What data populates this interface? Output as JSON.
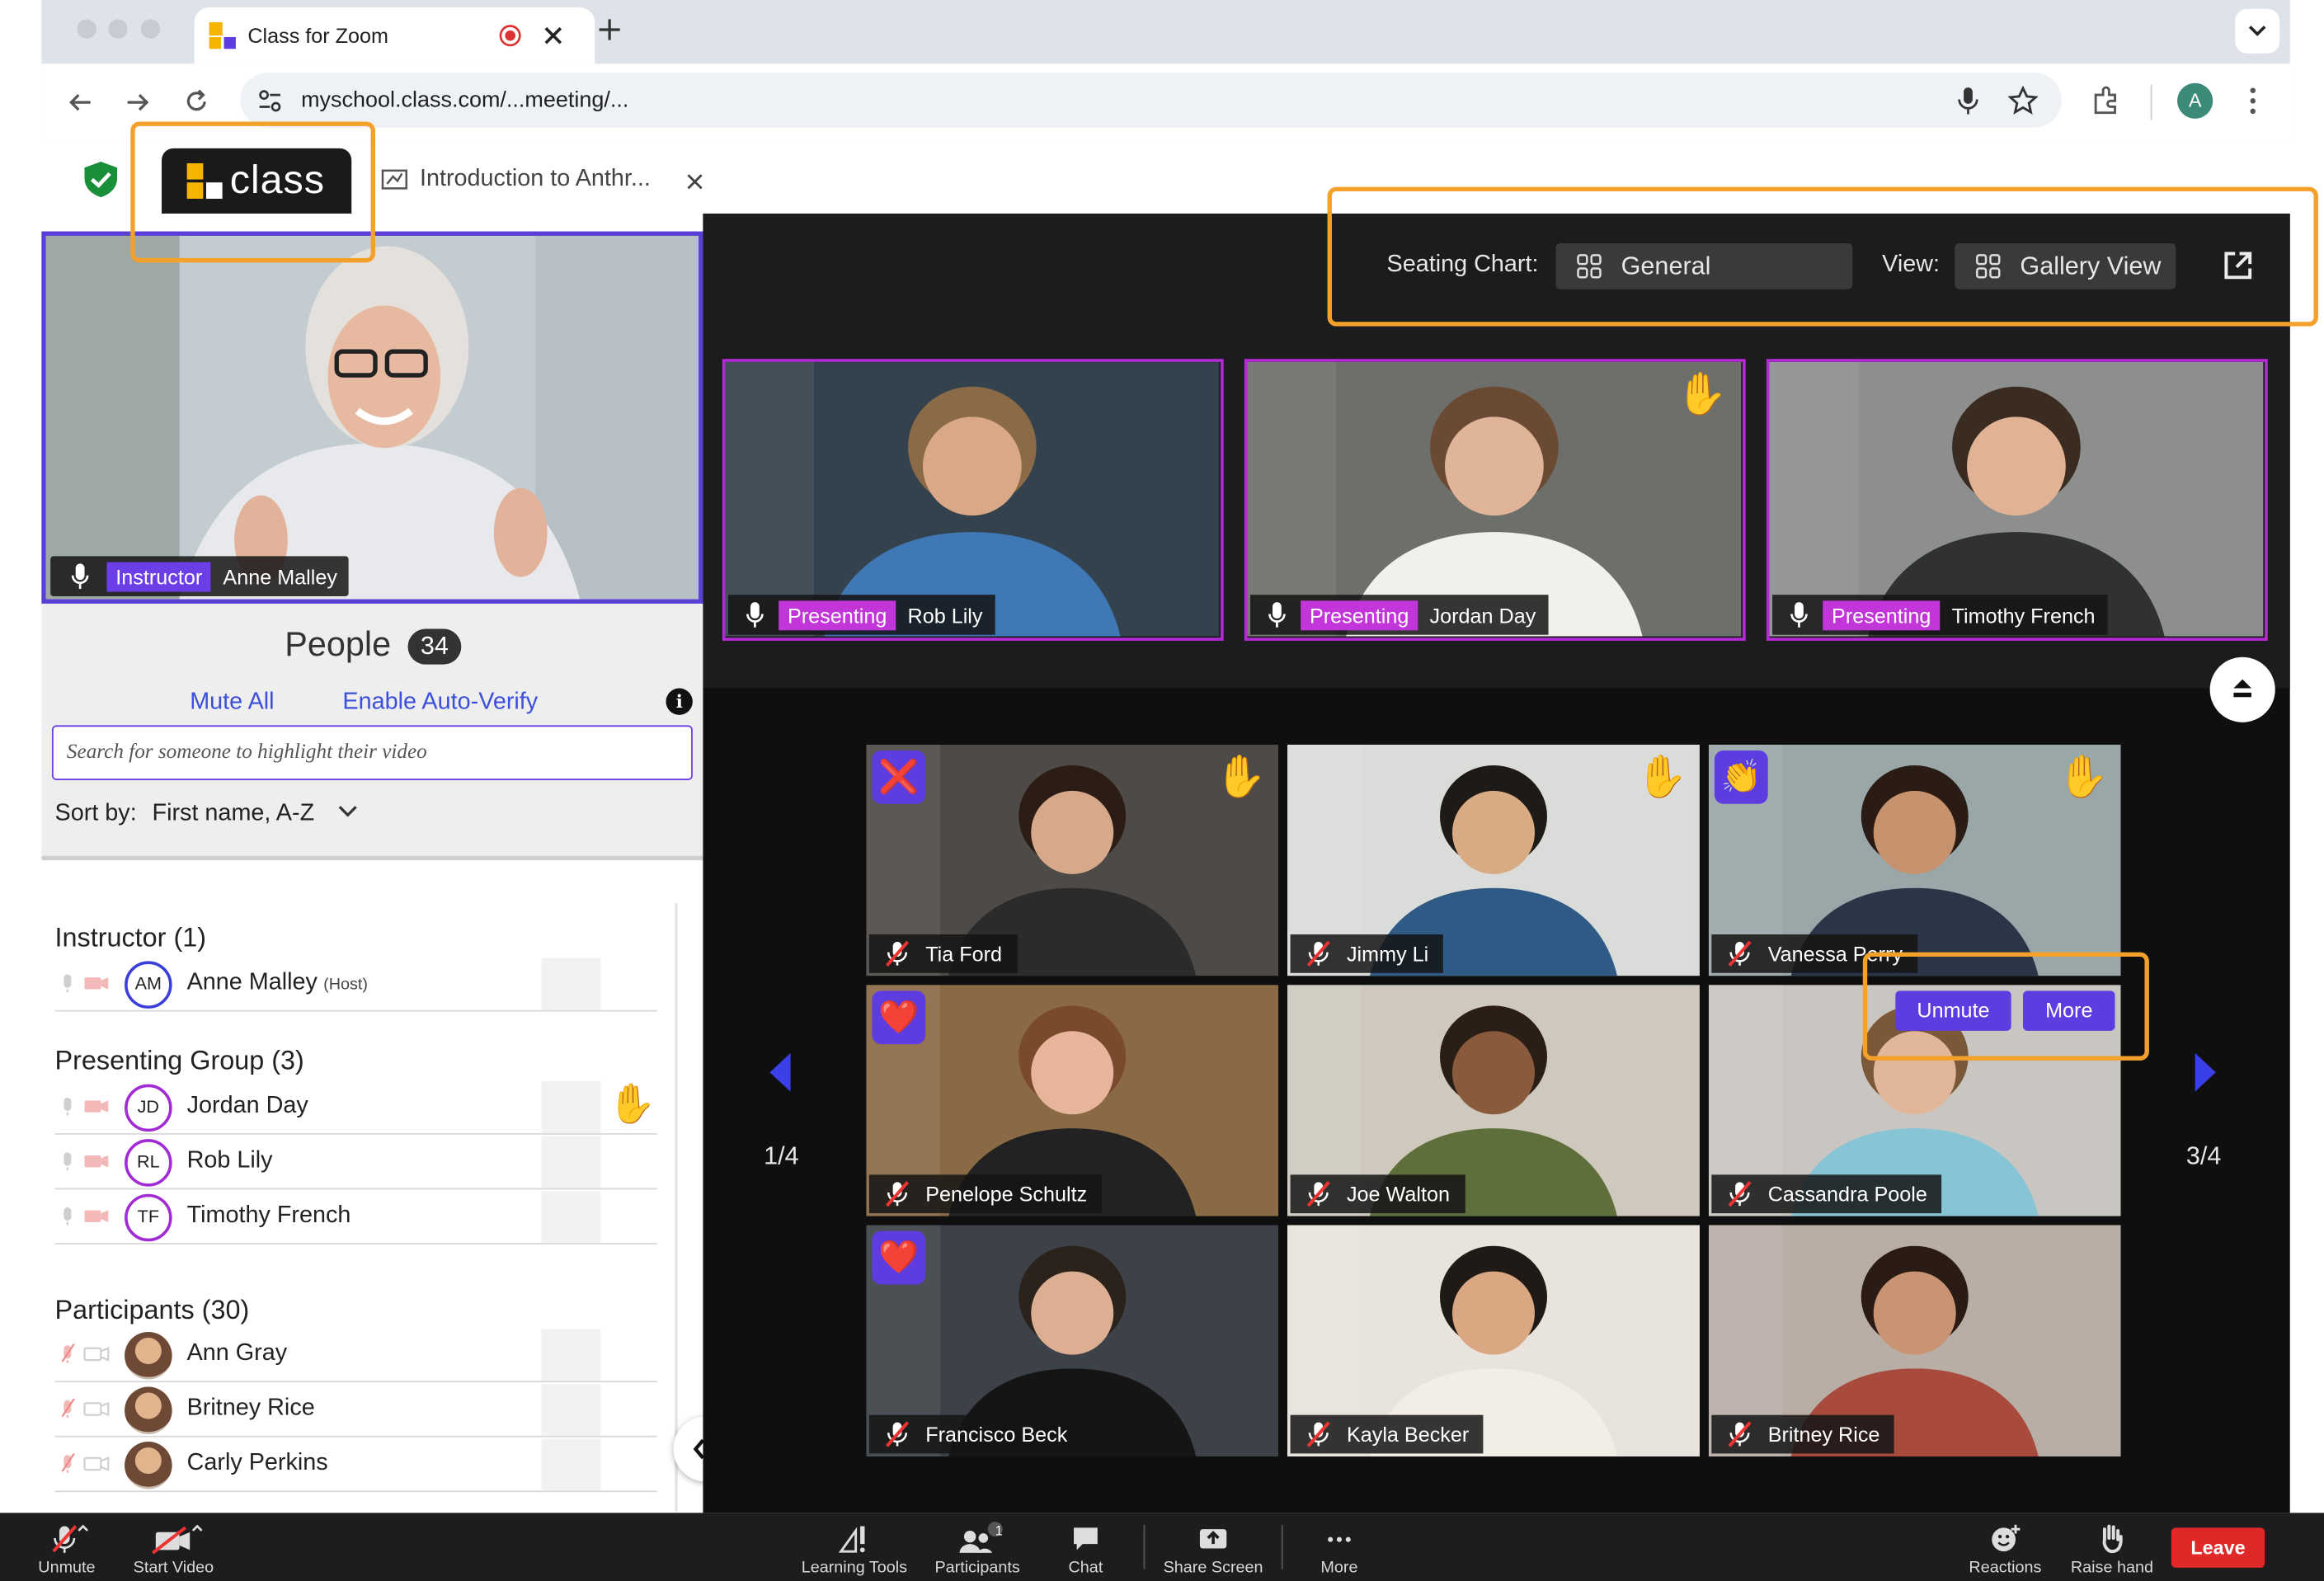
{
  "browser": {
    "tab_title": "Class for Zoom",
    "url": "myschool.class.com/...meeting/...",
    "profile_initial": "A"
  },
  "app": {
    "logo_text": "class",
    "secondary_tab": "Introduction to Anthr..."
  },
  "instructor_video": {
    "badge": "Instructor",
    "name": "Anne Malley"
  },
  "people": {
    "title": "People",
    "count": "34",
    "mute_all": "Mute All",
    "auto_verify": "Enable Auto-Verify",
    "search_placeholder": "Search for someone to highlight their video",
    "sort_label": "Sort by:",
    "sort_value": "First name, A-Z",
    "instructor_header": "Instructor (1)",
    "instructor": {
      "initials": "AM",
      "name": "Anne Malley",
      "tag": "(Host)"
    },
    "presenting_header": "Presenting Group  (3)",
    "presenting": [
      {
        "initials": "JD",
        "name": "Jordan Day",
        "hand": true
      },
      {
        "initials": "RL",
        "name": "Rob Lily",
        "hand": false
      },
      {
        "initials": "TF",
        "name": "Timothy French",
        "hand": false
      }
    ],
    "participants_header": "Participants  (30)",
    "participants": [
      {
        "name": "Ann Gray"
      },
      {
        "name": "Britney Rice"
      },
      {
        "name": "Carly Perkins"
      }
    ]
  },
  "seating": {
    "label": "Seating Chart:",
    "value": "General",
    "view_label": "View:",
    "view_value": "Gallery View"
  },
  "presenters": [
    {
      "badge": "Presenting",
      "name": "Rob Lily",
      "hand": false
    },
    {
      "badge": "Presenting",
      "name": "Jordan Day",
      "hand": true
    },
    {
      "badge": "Presenting",
      "name": "Timothy French",
      "hand": false
    }
  ],
  "gallery": {
    "page_left": "1/4",
    "page_right": "3/4",
    "unmute": "Unmute",
    "more": "More",
    "tiles": [
      {
        "name": "Tia Ford",
        "reaction": "cross",
        "hand": true
      },
      {
        "name": "Jimmy Li",
        "reaction": "",
        "hand": true
      },
      {
        "name": "Vanessa Perry",
        "reaction": "clap",
        "hand": true
      },
      {
        "name": "Penelope Schultz",
        "reaction": "heart",
        "hand": false
      },
      {
        "name": "Joe Walton",
        "reaction": "",
        "hand": false
      },
      {
        "name": "Cassandra Poole",
        "reaction": "",
        "hand": false
      },
      {
        "name": "Francisco Beck",
        "reaction": "heart",
        "hand": false
      },
      {
        "name": "Kayla Becker",
        "reaction": "",
        "hand": false
      },
      {
        "name": "Britney Rice",
        "reaction": "",
        "hand": false
      }
    ]
  },
  "toolbar": {
    "unmute": "Unmute",
    "start_video": "Start Video",
    "learning_tools": "Learning Tools",
    "participants": "Participants",
    "participants_badge": "1",
    "chat": "Chat",
    "share_screen": "Share Screen",
    "more": "More",
    "reactions": "Reactions",
    "raise_hand": "Raise hand",
    "leave": "Leave"
  },
  "colors": {
    "accent_purple": "#5d3ce0",
    "presenting_magenta": "#c235d8",
    "highlight_orange": "#f4a12b",
    "leave_red": "#e02828"
  }
}
